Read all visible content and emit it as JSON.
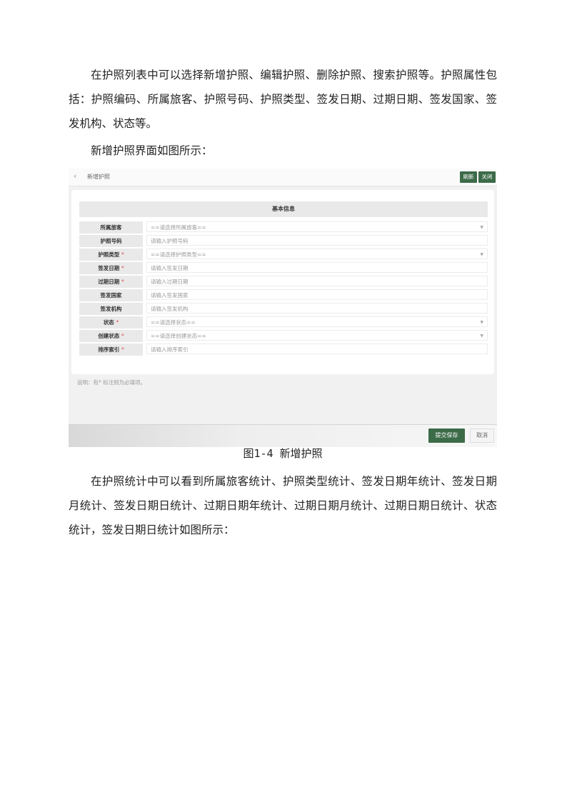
{
  "paragraphs": {
    "p1": "在护照列表中可以选择新增护照、编辑护照、删除护照、搜索护照等。护照属性包括：护照编码、所属旅客、护照号码、护照类型、签发日期、过期日期、签发国家、签发机构、状态等。",
    "p2": "新增护照界面如图所示：",
    "p3": "在护照统计中可以看到所属旅客统计、护照类型统计、签发日期年统计、签发日期月统计、签发日期日统计、过期日期年统计、过期日期月统计、过期日期日统计、状态统计，签发日期日统计如图所示："
  },
  "caption": "图1-4 新增护照",
  "screenshot": {
    "back_icon": "‹",
    "title": "新增护照",
    "refresh_label": "刷新",
    "close_label": "关闭",
    "section_title": "基本信息",
    "fields": [
      {
        "label": "所属旅客",
        "required": false,
        "placeholder": "==请选择所属旅客==",
        "type": "select"
      },
      {
        "label": "护照号码",
        "required": false,
        "placeholder": "请输入护照号码",
        "type": "input"
      },
      {
        "label": "护照类型",
        "required": true,
        "placeholder": "==请选择护照类型==",
        "type": "select"
      },
      {
        "label": "签发日期",
        "required": true,
        "placeholder": "请输入签发日期",
        "type": "input"
      },
      {
        "label": "过期日期",
        "required": true,
        "placeholder": "请输入过期日期",
        "type": "input"
      },
      {
        "label": "签发国家",
        "required": false,
        "placeholder": "请输入签发国家",
        "type": "input"
      },
      {
        "label": "签发机构",
        "required": false,
        "placeholder": "请输入签发机构",
        "type": "input"
      },
      {
        "label": "状态",
        "required": true,
        "placeholder": "==请选择状态==",
        "type": "select"
      },
      {
        "label": "创建状态",
        "required": true,
        "placeholder": "==请选择创建状态==",
        "type": "select"
      },
      {
        "label": "排序索引",
        "required": true,
        "placeholder": "请输入排序索引",
        "type": "input"
      }
    ],
    "required_mark": "*",
    "dropdown_icon": "▼",
    "note": "说明：有* 标注则为必填项。",
    "submit_label": "提交保存",
    "cancel_label": "取消",
    "accent_color": "#3c6b48"
  }
}
